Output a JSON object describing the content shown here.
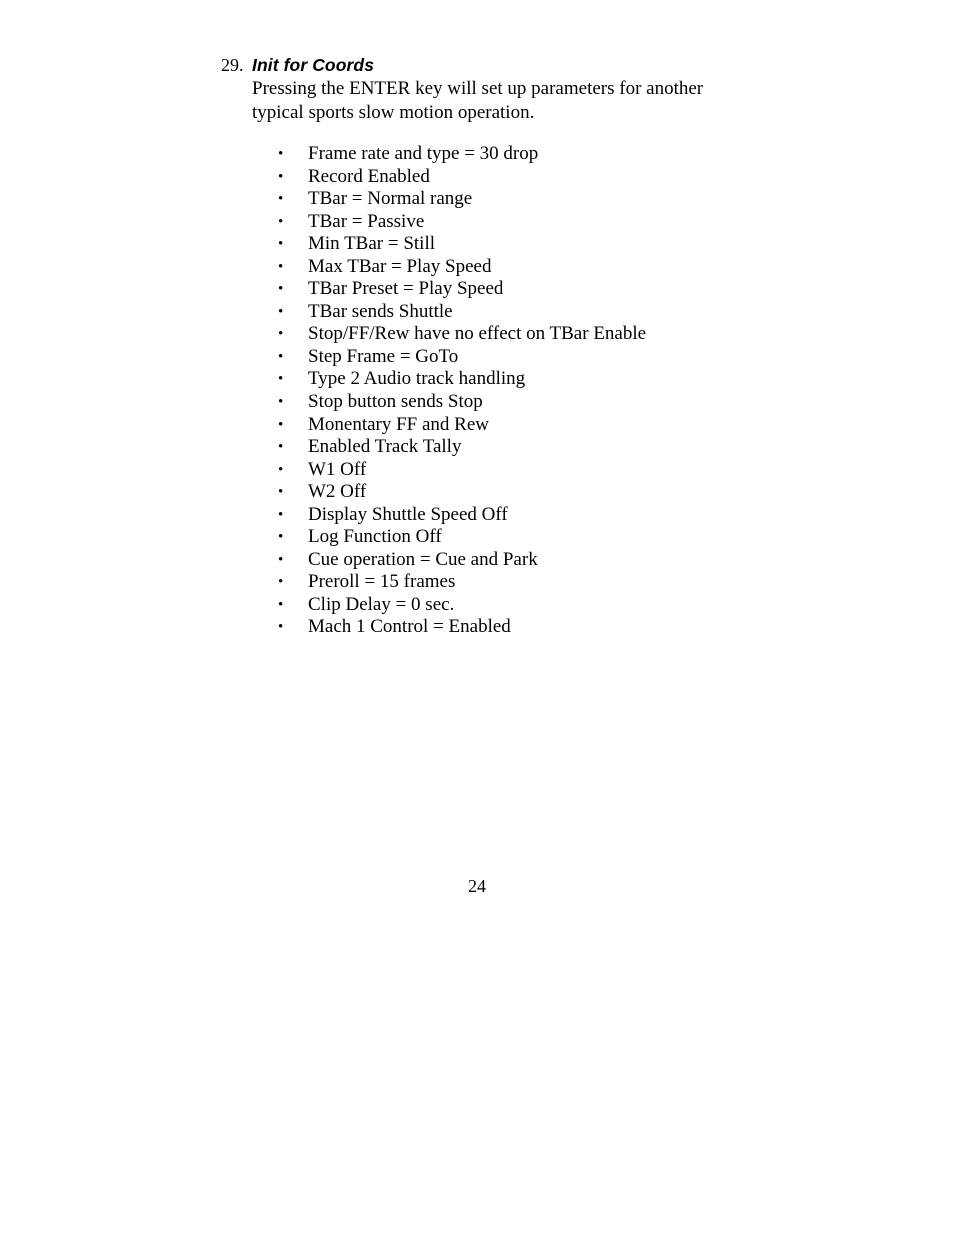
{
  "page": {
    "number": "24",
    "background_color": "#ffffff",
    "text_color": "#000000"
  },
  "section": {
    "number": "29.",
    "title": "Init for Coords",
    "body": "Pressing the ENTER key will set up parameters for another typical sports slow motion operation.",
    "bullet_marker": "•",
    "bullets": [
      "Frame rate and type = 30 drop",
      "Record Enabled",
      "TBar = Normal range",
      "TBar = Passive",
      "Min TBar = Still",
      "Max TBar = Play Speed",
      "TBar Preset = Play Speed",
      "TBar sends Shuttle",
      "Stop/FF/Rew have no effect on TBar Enable",
      "Step Frame = GoTo",
      "Type 2 Audio track handling",
      "Stop button sends Stop",
      "Monentary FF and Rew",
      "Enabled Track Tally",
      "W1 Off",
      "W2 Off",
      "Display Shuttle Speed Off",
      "Log Function Off",
      "Cue operation = Cue and Park",
      "Preroll = 15 frames",
      "Clip Delay = 0 sec.",
      "Mach 1 Control = Enabled"
    ]
  }
}
